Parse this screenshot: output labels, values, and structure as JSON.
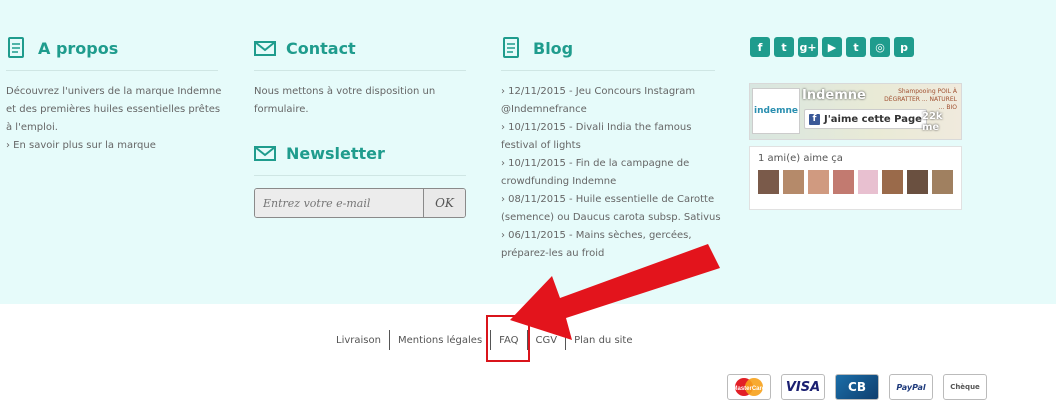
{
  "about": {
    "title": "A propos",
    "lines": [
      "Découvrez l'univers de la marque Indemne",
      "et des premières huiles essentielles prêtes",
      "à l'emploi."
    ],
    "more_link": "› En savoir plus sur la marque"
  },
  "contact": {
    "title": "Contact",
    "lines": [
      "Nous mettons à votre disposition un",
      "formulaire."
    ]
  },
  "newsletter": {
    "title": "Newsletter",
    "placeholder": "Entrez votre e-mail",
    "button": "OK"
  },
  "blog": {
    "title": "Blog",
    "lines": [
      "› 12/11/2015 - Jeu Concours Instagram",
      "@Indemnefrance",
      "› 10/11/2015 - Divali India the famous",
      "festival of lights",
      "› 10/11/2015 - Fin de la campagne de",
      "crowdfunding Indemne",
      "› 08/11/2015 - Huile essentielle de Carotte",
      "(semence) ou Daucus carota subsp. Sativus",
      "› 06/11/2015 - Mains sèches, gercées,",
      "préparez-les au froid"
    ]
  },
  "social": {
    "icons": [
      "facebook-icon",
      "twitter-icon",
      "google-plus-icon",
      "youtube-icon",
      "tumblr-icon",
      "instagram-icon",
      "pinterest-icon"
    ],
    "glyphs": [
      "f",
      "t",
      "g+",
      "▶",
      "t",
      "◎",
      "p"
    ]
  },
  "facebook": {
    "logo_text": "indemne",
    "page_name": "Indemne",
    "like_label": "J'aime cette Page",
    "count": "22k me",
    "cover_tagline": "Shampooing POIL À DÉGRATTER ... NATUREL ... BIO",
    "friends_text": "1 ami(e) aime ça",
    "avatar_colors": [
      "#7a5a4a",
      "#b58a6a",
      "#d09a80",
      "#c27a70",
      "#e8c0d0",
      "#9a6a4a",
      "#6a5040",
      "#a08060"
    ]
  },
  "bottom_nav": [
    "Livraison",
    "Mentions légales",
    "FAQ",
    "CGV",
    "Plan du site"
  ],
  "payments": [
    "MasterCard",
    "VISA",
    "CB",
    "PayPal",
    "Chèque"
  ],
  "colors": {
    "accent": "#1f9c8d",
    "footer_bg": "#e6fbfa",
    "highlight": "#d9141b"
  }
}
